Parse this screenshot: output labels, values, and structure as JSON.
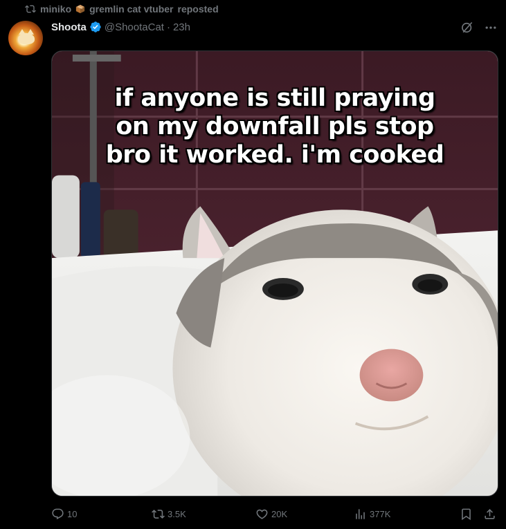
{
  "repost": {
    "icon": "repost-icon",
    "user1": "miniko",
    "emoji": "package-emoji",
    "user2": "gremlin cat vtuber",
    "suffix": "reposted"
  },
  "author": {
    "name": "Shoota",
    "handle": "@ShootaCat",
    "separator": "·",
    "time": "23h",
    "verified_color": "#1d9bf0"
  },
  "media": {
    "caption_lines": [
      "if anyone is still praying",
      "on my downfall pls stop",
      "bro it worked. i'm cooked"
    ]
  },
  "actions": {
    "replies": "10",
    "reposts": "3.5K",
    "likes": "20K",
    "views": "377K"
  },
  "colors": {
    "background": "#000000",
    "text_primary": "#e7e9ea",
    "text_secondary": "#71767b",
    "accent": "#1d9bf0"
  }
}
